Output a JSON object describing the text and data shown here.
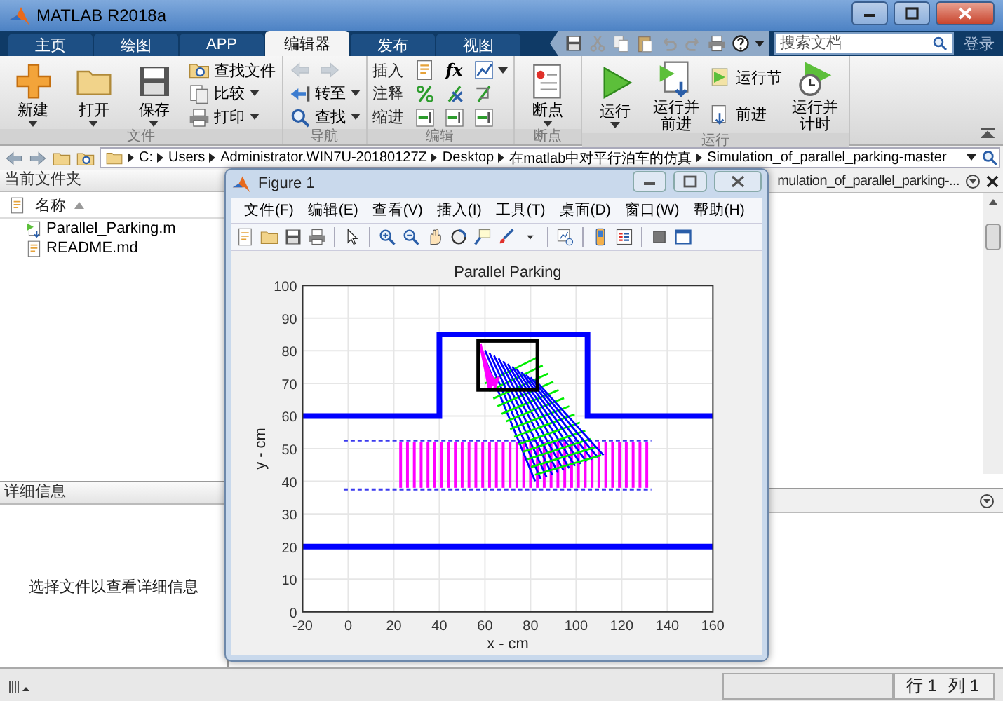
{
  "window": {
    "title": "MATLAB R2018a"
  },
  "tabs": [
    {
      "label": "主页",
      "selected": false
    },
    {
      "label": "绘图",
      "selected": false
    },
    {
      "label": "APP",
      "selected": false
    },
    {
      "label": "编辑器",
      "selected": true
    },
    {
      "label": "发布",
      "selected": false
    },
    {
      "label": "视图",
      "selected": false
    }
  ],
  "quick_access": {
    "search": {
      "placeholder": "搜索文档"
    },
    "login": "登录"
  },
  "ribbon": {
    "groups": [
      {
        "label": "文件",
        "columns": [
          [
            [
              {
                "kind": "large",
                "label": "新建",
                "dropdown": true,
                "disabled": false
              }
            ]
          ],
          [
            [
              {
                "kind": "large",
                "label": "打开",
                "dropdown": true,
                "disabled": false
              }
            ]
          ],
          [
            [
              {
                "kind": "large",
                "label": "保存",
                "dropdown": true,
                "disabled": false
              }
            ]
          ],
          [
            [
              {
                "kind": "small",
                "label": "查找文件",
                "dropdown": false,
                "disabled": false
              }
            ],
            [
              {
                "kind": "small",
                "label": "比较",
                "dropdown": true,
                "disabled": false
              }
            ],
            [
              {
                "kind": "small",
                "label": "打印",
                "dropdown": true,
                "disabled": false
              }
            ]
          ]
        ]
      },
      {
        "label": "导航",
        "columns": [
          [
            [
              {
                "kind": "icon",
                "dropdown": false,
                "disabled": true
              },
              {
                "kind": "icon",
                "dropdown": false,
                "disabled": true
              }
            ],
            [
              {
                "kind": "small",
                "label": "转至",
                "dropdown": true,
                "disabled": false
              }
            ],
            [
              {
                "kind": "small",
                "label": "查找",
                "dropdown": true,
                "disabled": false
              }
            ]
          ]
        ]
      },
      {
        "label": "编辑",
        "columns": [
          [
            [
              {
                "kind": "text",
                "label": "插入",
                "dropdown": false,
                "disabled": false
              },
              {
                "kind": "icon",
                "dropdown": false,
                "disabled": false
              },
              {
                "kind": "glyph",
                "label": "fx",
                "dropdown": false,
                "disabled": false
              },
              {
                "kind": "icon",
                "dropdown": true,
                "disabled": false
              }
            ],
            [
              {
                "kind": "text",
                "label": "注释",
                "dropdown": false,
                "disabled": false
              },
              {
                "kind": "icon",
                "dropdown": false,
                "disabled": false
              },
              {
                "kind": "icon",
                "dropdown": false,
                "disabled": false
              },
              {
                "kind": "icon",
                "dropdown": false,
                "disabled": false
              }
            ],
            [
              {
                "kind": "text",
                "label": "缩进",
                "dropdown": false,
                "disabled": false
              },
              {
                "kind": "icon",
                "dropdown": false,
                "disabled": false
              },
              {
                "kind": "icon",
                "dropdown": false,
                "disabled": false
              },
              {
                "kind": "icon",
                "dropdown": false,
                "disabled": false
              }
            ]
          ]
        ]
      },
      {
        "label": "断点",
        "columns": [
          [
            [
              {
                "kind": "large",
                "label": "断点",
                "dropdown": true,
                "disabled": false
              }
            ]
          ]
        ]
      },
      {
        "label": "运行",
        "columns": [
          [
            [
              {
                "kind": "large",
                "label": "运行",
                "dropdown": true,
                "disabled": false
              }
            ]
          ],
          [
            [
              {
                "kind": "large",
                "label": "运行并前进",
                "dropdown": false,
                "disabled": false
              }
            ]
          ],
          [
            [
              {
                "kind": "small",
                "label": "运行节",
                "dropdown": false,
                "disabled": false
              }
            ],
            [
              {
                "kind": "small",
                "label": "前进",
                "dropdown": false,
                "disabled": false
              }
            ]
          ],
          [
            [
              {
                "kind": "large",
                "label": "运行并计时",
                "dropdown": false,
                "disabled": false
              }
            ]
          ]
        ]
      }
    ]
  },
  "address_bar": {
    "path": [
      "C:",
      "Users",
      "Administrator.WIN7U-20180127Z",
      "Desktop",
      "在matlab中对平行泊车的仿真",
      "Simulation_of_parallel_parking-master"
    ]
  },
  "current_folder": {
    "title": "当前文件夹",
    "column": "名称",
    "files": [
      {
        "name": "Parallel_Parking.m",
        "kind": "script"
      },
      {
        "name": "README.md",
        "kind": "text"
      }
    ]
  },
  "details": {
    "title": "详细信息",
    "message": "选择文件以查看详细信息"
  },
  "editor": {
    "tab": "mulation_of_parallel_parking-..."
  },
  "figure": {
    "title": "Figure 1",
    "menus": [
      "文件(F)",
      "编辑(E)",
      "查看(V)",
      "插入(I)",
      "工具(T)",
      "桌面(D)",
      "窗口(W)",
      "帮助(H)"
    ],
    "chart_data": {
      "type": "line",
      "title": "Parallel Parking",
      "xlabel": "x - cm",
      "ylabel": "y - cm",
      "x": [
        -20,
        40,
        40,
        105,
        105,
        160
      ],
      "series": [
        {
          "color": "#0000ff",
          "values": [
            60,
            60,
            85,
            85,
            60,
            60
          ]
        },
        {
          "color": "#0000ff",
          "values": [
            20,
            20,
            20,
            20,
            20,
            20
          ]
        }
      ],
      "ref_lines": [
        {
          "axis": "y",
          "value": 52.5,
          "color": "#3a3aee"
        },
        {
          "axis": "y",
          "value": 37.5,
          "color": "#3a3aee"
        }
      ],
      "grid": true,
      "xlim": [
        -20,
        160
      ],
      "ylim": [
        0,
        100
      ],
      "xticks": [
        -20,
        0,
        20,
        40,
        60,
        80,
        100,
        120,
        140,
        160
      ],
      "yticks": [
        0,
        10,
        20,
        30,
        40,
        50,
        60,
        70,
        80,
        90,
        100
      ]
    }
  },
  "status_bar": {
    "fields": [
      {
        "label": "行",
        "value": "1"
      },
      {
        "label": "列",
        "value": "1"
      }
    ]
  }
}
